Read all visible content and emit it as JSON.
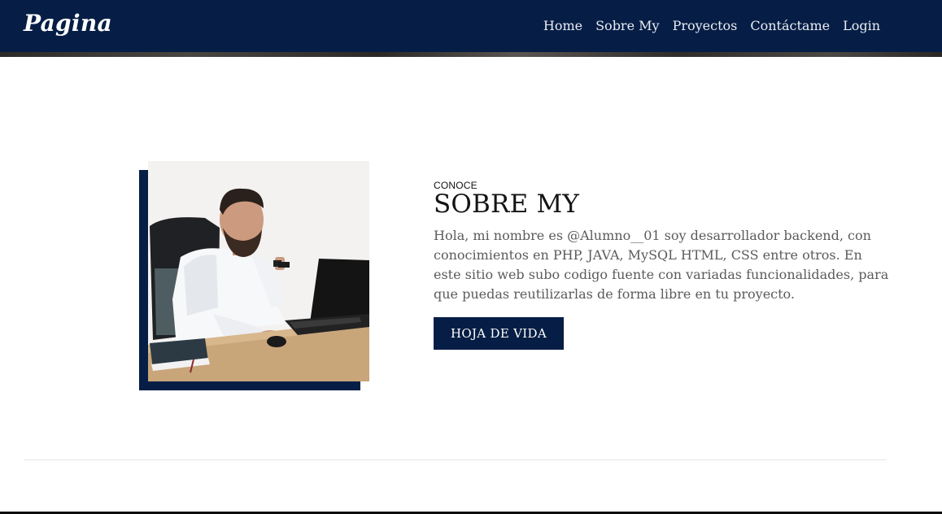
{
  "navbar": {
    "brand": "Pagina",
    "links": [
      {
        "label": "Home"
      },
      {
        "label": "Sobre My"
      },
      {
        "label": "Proyectos"
      },
      {
        "label": "Contáctame"
      },
      {
        "label": "Login"
      }
    ]
  },
  "about": {
    "eyebrow": "CONOCE",
    "title": "SOBRE MY",
    "text": "Hola, mi nombre es @Alumno__01 soy desarrollador backend, con conocimientos en PHP, JAVA, MySQL HTML, CSS entre otros. En este sitio web subo codigo fuente con variadas funcionalidades, para que puedas reutilizarlas de forma libre en tu proyecto.",
    "button_label": "HOJA DE VIDA"
  },
  "colors": {
    "primary": "#061e45",
    "text_muted": "#5b5b5b",
    "heading": "#141414"
  }
}
